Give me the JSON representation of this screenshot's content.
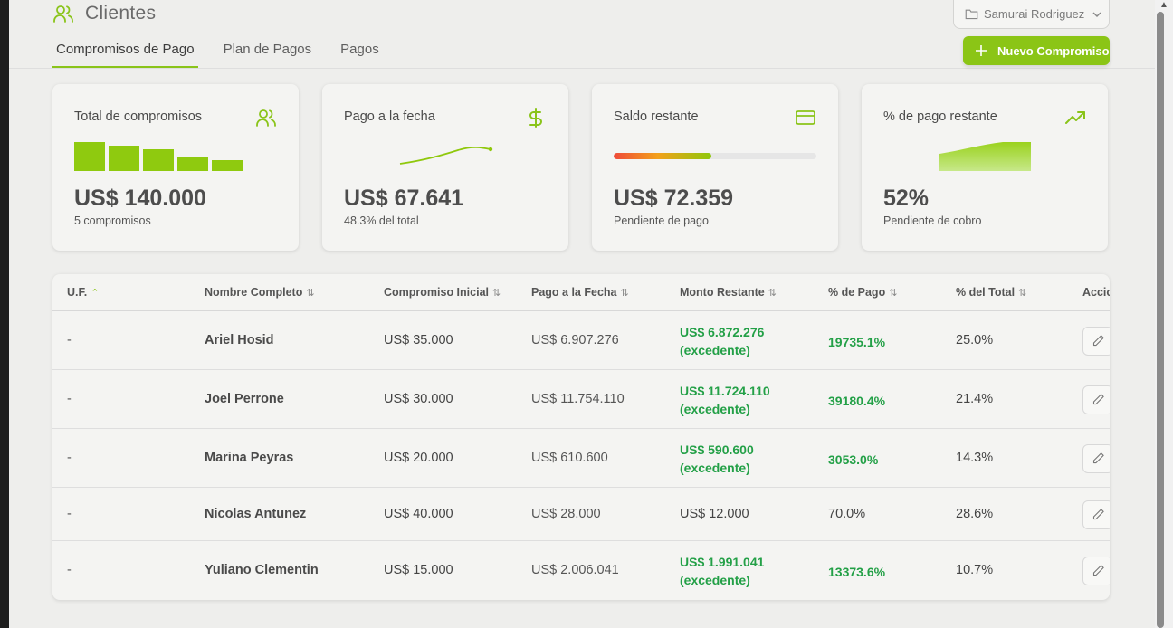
{
  "header": {
    "title": "Clientes",
    "user_select": "Samurai Rodriguez"
  },
  "tabs": [
    {
      "label": "Compromisos de Pago",
      "active": true
    },
    {
      "label": "Plan de Pagos",
      "active": false
    },
    {
      "label": "Pagos",
      "active": false
    }
  ],
  "new_button": {
    "label": "Nuevo Compromiso"
  },
  "cards": [
    {
      "label": "Total de compromisos",
      "value": "US$ 140.000",
      "sub": "5 compromisos",
      "icon": "users-icon"
    },
    {
      "label": "Pago a la fecha",
      "value": "US$ 67.641",
      "sub": "48.3% del total",
      "icon": "dollar-icon"
    },
    {
      "label": "Saldo restante",
      "value": "US$ 72.359",
      "sub": "Pendiente de pago",
      "icon": "credit-card-icon",
      "progress": 0.483
    },
    {
      "label": "% de pago restante",
      "value": "52%",
      "sub": "Pendiente de cobro",
      "icon": "trending-up-icon"
    }
  ],
  "accent_color": "#8bc516",
  "positive_color": "#23a047",
  "table": {
    "columns": [
      "U.F.",
      "Nombre Completo",
      "Compromiso Inicial",
      "Pago a la Fecha",
      "Monto Restante",
      "% de Pago",
      "% del Total",
      "Acciones"
    ],
    "rows": [
      {
        "uf": "-",
        "nombre": "Ariel Hosid",
        "compromiso": "US$ 35.000",
        "pago": "US$ 6.907.276",
        "restante": "US$ 6.872.276",
        "restante_note": "(excedente)",
        "pct_pago": "19735.1%",
        "pct_total": "25.0%",
        "excedente": true
      },
      {
        "uf": "-",
        "nombre": "Joel Perrone",
        "compromiso": "US$ 30.000",
        "pago": "US$ 11.754.110",
        "restante": "US$ 11.724.110",
        "restante_note": "(excedente)",
        "pct_pago": "39180.4%",
        "pct_total": "21.4%",
        "excedente": true
      },
      {
        "uf": "-",
        "nombre": "Marina Peyras",
        "compromiso": "US$ 20.000",
        "pago": "US$ 610.600",
        "restante": "US$ 590.600",
        "restante_note": "(excedente)",
        "pct_pago": "3053.0%",
        "pct_total": "14.3%",
        "excedente": true
      },
      {
        "uf": "-",
        "nombre": "Nicolas Antunez",
        "compromiso": "US$ 40.000",
        "pago": "US$ 28.000",
        "restante": "US$ 12.000",
        "restante_note": "",
        "pct_pago": "70.0%",
        "pct_total": "28.6%",
        "excedente": false
      },
      {
        "uf": "-",
        "nombre": "Yuliano Clementin",
        "compromiso": "US$ 15.000",
        "pago": "US$ 2.006.041",
        "restante": "US$ 1.991.041",
        "restante_note": "(excedente)",
        "pct_pago": "13373.6%",
        "pct_total": "10.7%",
        "excedente": true
      }
    ]
  }
}
